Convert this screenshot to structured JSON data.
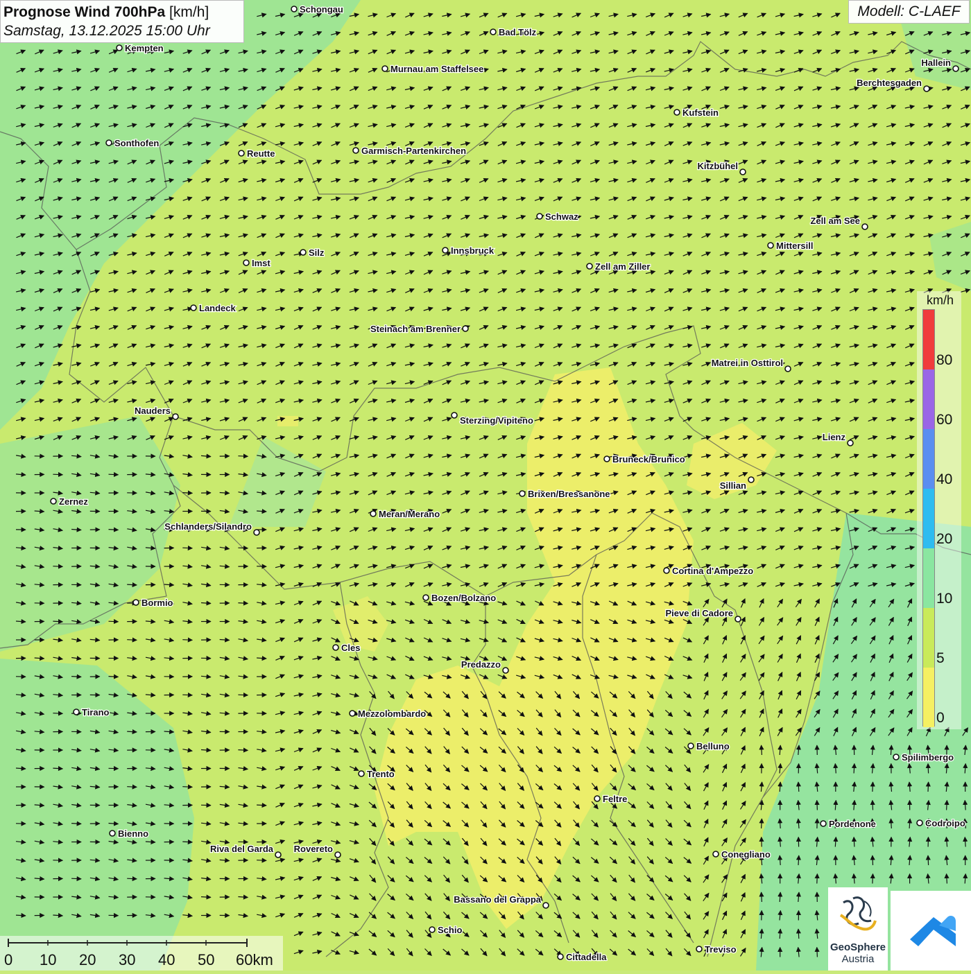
{
  "title": {
    "main": "Prognose Wind 700hPa",
    "unit": "[km/h]",
    "datetime": "Samstag, 13.12.2025 15:00 Uhr"
  },
  "model": "Modell: C-LAEF",
  "legend": {
    "unit": "km/h",
    "labels": [
      "80",
      "60",
      "40",
      "20",
      "10",
      "5",
      "0"
    ],
    "colors": [
      "#f03c3c",
      "#9a66e6",
      "#5a8ef0",
      "#2ebcf0",
      "#8ae6a0",
      "#c9ea5a",
      "#f5f062"
    ]
  },
  "scale": {
    "labels": [
      "0",
      "10",
      "20",
      "30",
      "40",
      "50",
      "60km"
    ]
  },
  "places": [
    {
      "name": "Schongau"
    },
    {
      "name": "Kempten"
    },
    {
      "name": "Bad Tölz"
    },
    {
      "name": "Murnau am Staffelsee"
    },
    {
      "name": "Hallein"
    },
    {
      "name": "Berchtesgaden"
    },
    {
      "name": "Kufstein"
    },
    {
      "name": "Sonthofen"
    },
    {
      "name": "Reutte"
    },
    {
      "name": "Garmisch-Partenkirchen"
    },
    {
      "name": "Kitzbühel"
    },
    {
      "name": "Schwaz"
    },
    {
      "name": "Zell am See"
    },
    {
      "name": "Mittersill"
    },
    {
      "name": "Silz"
    },
    {
      "name": "Innsbruck"
    },
    {
      "name": "Imst"
    },
    {
      "name": "Zell am Ziller"
    },
    {
      "name": "Landeck"
    },
    {
      "name": "Steinach am Brenner"
    },
    {
      "name": "Matrei in Osttirol"
    },
    {
      "name": "Nauders"
    },
    {
      "name": "Sterzing/Vipiteno"
    },
    {
      "name": "Lienz"
    },
    {
      "name": "Bruneck/Brunico"
    },
    {
      "name": "Sillian"
    },
    {
      "name": "Brixen/Bressanone"
    },
    {
      "name": "Zernez"
    },
    {
      "name": "Meran/Merano"
    },
    {
      "name": "Schlanders/Silandro"
    },
    {
      "name": "Cortina d'Ampezzo"
    },
    {
      "name": "Bozen/Bolzano"
    },
    {
      "name": "Bormio"
    },
    {
      "name": "Pieve di Cadore"
    },
    {
      "name": "Cles"
    },
    {
      "name": "Predazzo"
    },
    {
      "name": "Tirano"
    },
    {
      "name": "Mezzolombardo"
    },
    {
      "name": "Belluno"
    },
    {
      "name": "Spilimbergo"
    },
    {
      "name": "Trento"
    },
    {
      "name": "Feltre"
    },
    {
      "name": "Pordenone"
    },
    {
      "name": "Codroipo"
    },
    {
      "name": "Bienno"
    },
    {
      "name": "Riva del Garda"
    },
    {
      "name": "Rovereto"
    },
    {
      "name": "Conegliano"
    },
    {
      "name": "Bassano del Grappa"
    },
    {
      "name": "Schio"
    },
    {
      "name": "Treviso"
    },
    {
      "name": "Cittadella"
    }
  ],
  "logo": {
    "line1": "GeoSphere",
    "line2": "Austria"
  }
}
